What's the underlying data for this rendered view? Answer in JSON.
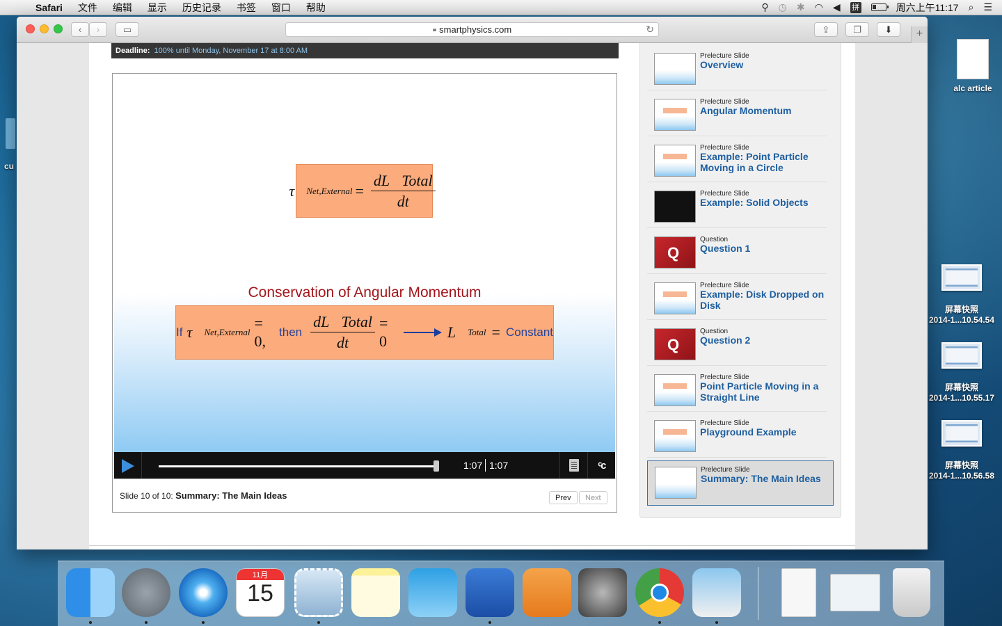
{
  "menubar": {
    "app": "Safari",
    "menus": [
      "文件",
      "编辑",
      "显示",
      "历史记录",
      "书签",
      "窗口",
      "帮助"
    ],
    "clock": "周六上午11:17",
    "ime": "拼"
  },
  "browser": {
    "url": "smartphysics.com"
  },
  "deadline": {
    "label": "Deadline:",
    "value": "100% until Monday, November 17 at 8:00 AM"
  },
  "slide": {
    "eq1": {
      "tau": "τ⃗",
      "sub": "Net,External",
      "num": "dL⃗Total",
      "den": "dt"
    },
    "conservation_title": "Conservation of Angular Momentum",
    "eq2": {
      "if": "If",
      "tau": "τ⃗",
      "sub": "Net,External",
      "eq0": "= 0,",
      "then": "then",
      "num": "dL⃗Total",
      "den": "dt",
      "eq0b": "= 0",
      "L": "L⃗",
      "lsub": "Total",
      "eq": "=",
      "constant": "Constant"
    }
  },
  "player": {
    "current_time": "1:07",
    "duration": "1:07",
    "progress": 1.0
  },
  "footer": {
    "slide_info": "Slide 10 of 10:",
    "slide_title": "Summary: The Main Ideas",
    "prev": "Prev",
    "next": "Next"
  },
  "sidebar": {
    "items": [
      {
        "type": "Prelecture Slide",
        "title": "Overview"
      },
      {
        "type": "Prelecture Slide",
        "title": "Angular Momentum"
      },
      {
        "type": "Prelecture Slide",
        "title": "Example: Point Particle Moving in a Circle"
      },
      {
        "type": "Prelecture Slide",
        "title": "Example: Solid Objects"
      },
      {
        "type": "Question",
        "title": "Question 1"
      },
      {
        "type": "Prelecture Slide",
        "title": "Example: Disk Dropped on Disk"
      },
      {
        "type": "Question",
        "title": "Question 2"
      },
      {
        "type": "Prelecture Slide",
        "title": "Point Particle Moving in a Straight Line"
      },
      {
        "type": "Prelecture Slide",
        "title": "Playground Example"
      },
      {
        "type": "Prelecture Slide",
        "title": "Summary: The Main Ideas"
      }
    ]
  },
  "desktop": {
    "icons": [
      {
        "label": "alc article"
      },
      {
        "label": "屏幕快照",
        "sub": "2014-1...10.54.54"
      },
      {
        "label": "屏幕快照",
        "sub": "2014-1...10.55.17"
      },
      {
        "label": "屏幕快照",
        "sub": "2014-1...10.56.58"
      }
    ],
    "left_partial": "cu"
  },
  "dock": {
    "calendar_month": "11月",
    "calendar_day": "15"
  }
}
